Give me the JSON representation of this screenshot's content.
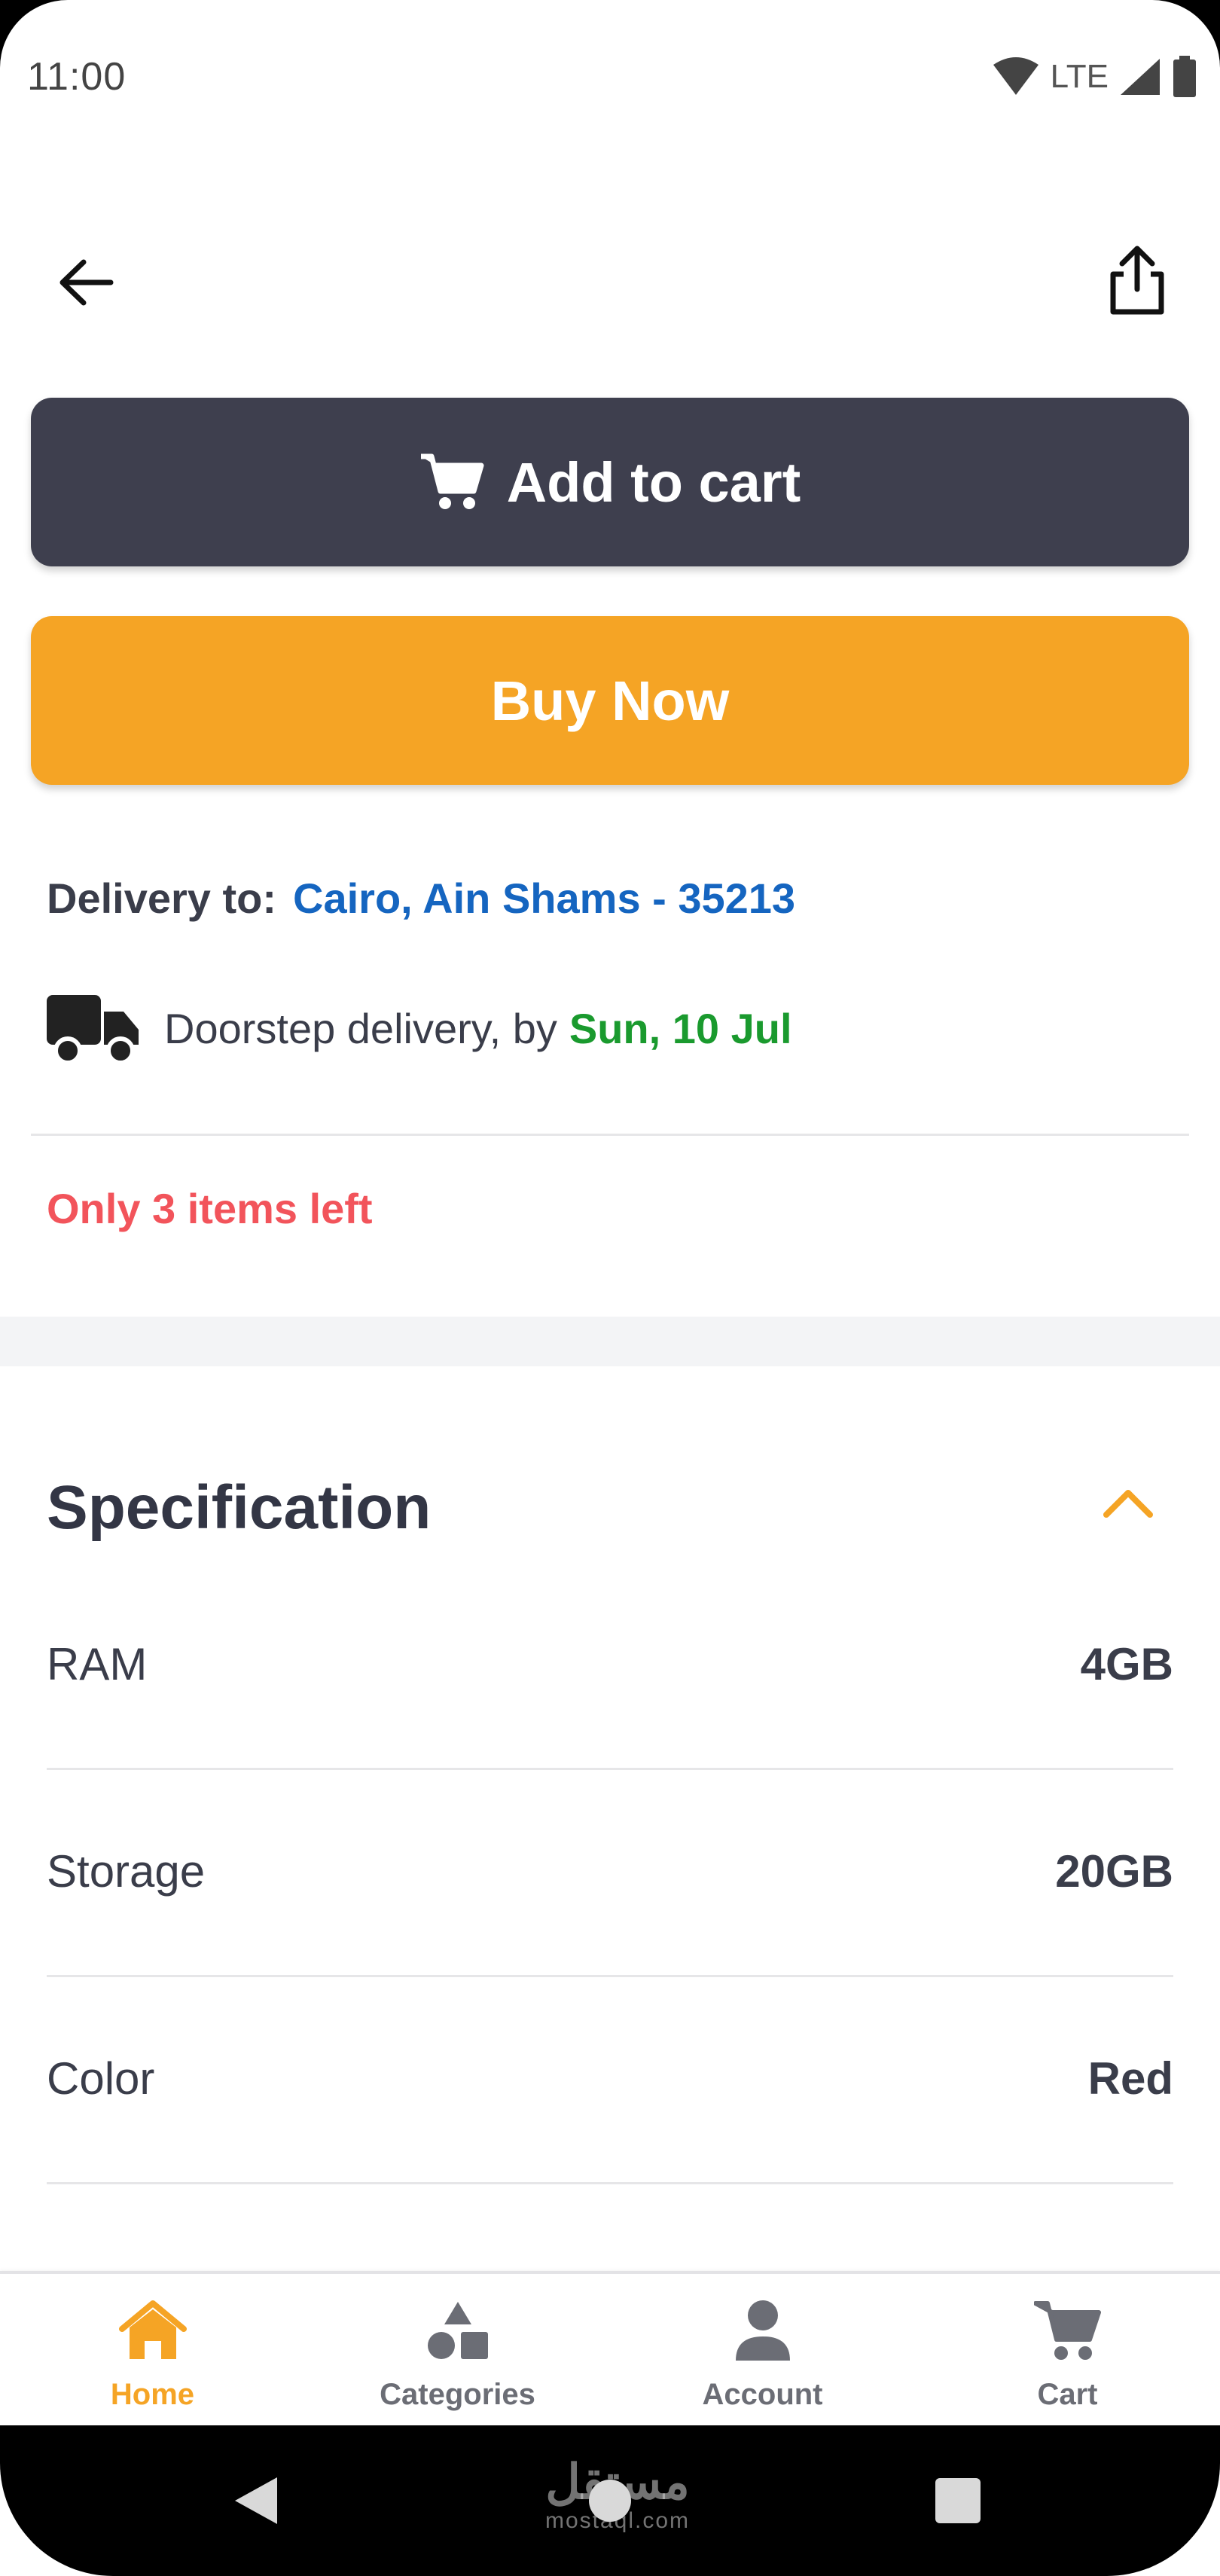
{
  "status_bar": {
    "time": "11:00",
    "network": "LTE"
  },
  "actions": {
    "add_to_cart_label": "Add to cart",
    "buy_now_label": "Buy Now"
  },
  "delivery": {
    "label": "Delivery to:",
    "address": "Cairo, Ain Shams - 35213",
    "method_text": "Doorstep delivery, by",
    "date": "Sun, 10 Jul"
  },
  "stock": {
    "warning": "Only 3 items left"
  },
  "specification": {
    "title": "Specification",
    "rows": [
      {
        "key": "RAM",
        "value": "4GB"
      },
      {
        "key": "Storage",
        "value": "20GB"
      },
      {
        "key": "Color",
        "value": "Red"
      }
    ]
  },
  "bottom_nav": {
    "items": [
      {
        "label": "Home",
        "icon": "home-icon",
        "active": true
      },
      {
        "label": "Categories",
        "icon": "categories-icon",
        "active": false
      },
      {
        "label": "Account",
        "icon": "account-icon",
        "active": false
      },
      {
        "label": "Cart",
        "icon": "cart-icon",
        "active": false
      }
    ]
  },
  "watermark": {
    "text": "مستقل",
    "sub": "mostaql.com"
  },
  "colors": {
    "accent": "#f5a425",
    "dark_button": "#3e3f4e",
    "link_blue": "#1565c0",
    "success_green": "#1a9a2e",
    "warning_red": "#f2545b"
  }
}
